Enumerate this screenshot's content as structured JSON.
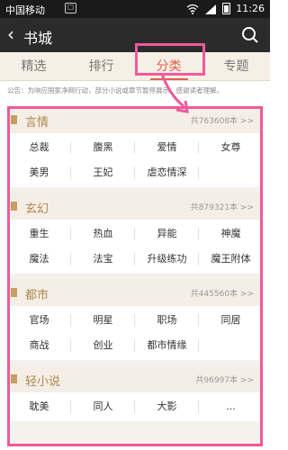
{
  "status_bar": {
    "carrier": "中国移动",
    "time": "11:26"
  },
  "nav": {
    "title": "书城"
  },
  "tabs": [
    "精选",
    "排行",
    "分类",
    "专题"
  ],
  "notice": "公告：为响应国家净网行动，部分小说或章节暂停展示，感谢读者理解。",
  "categories": [
    {
      "name": "言情",
      "count": "共763608本 >>",
      "items": [
        "总裁",
        "腹黑",
        "爱情",
        "女尊",
        "美男",
        "王妃",
        "虐恋情深"
      ]
    },
    {
      "name": "玄幻",
      "count": "共879321本 >>",
      "items": [
        "重生",
        "热血",
        "异能",
        "神魔",
        "魔法",
        "法宝",
        "升级练功",
        "魔王附体"
      ]
    },
    {
      "name": "都市",
      "count": "共445560本 >>",
      "items": [
        "官场",
        "明星",
        "职场",
        "同居",
        "商战",
        "创业",
        "都市情缘"
      ]
    },
    {
      "name": "轻小说",
      "count": "共96997本 >>",
      "items": [
        "耽美",
        "同人",
        "大影",
        "..."
      ]
    }
  ],
  "colors": {
    "highlight": "#ef5a9a",
    "accent": "#e2604e",
    "category_text": "#b08850"
  }
}
